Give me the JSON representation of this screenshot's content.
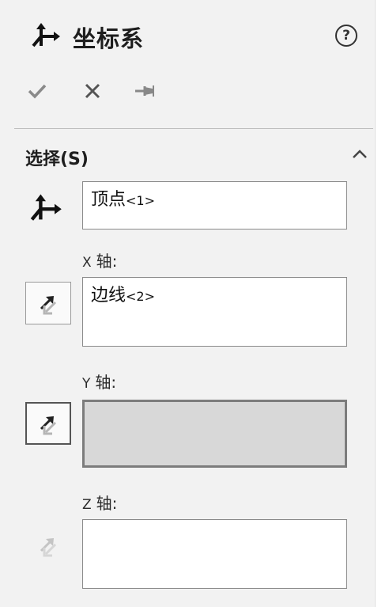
{
  "header": {
    "title": "坐标系",
    "help": "?",
    "icons": [
      "coordinate-system-icon",
      "help-icon",
      "check-icon",
      "close-icon",
      "pin-icon"
    ]
  },
  "selection": {
    "label": "选择(S)",
    "origin": {
      "value": "顶点",
      "count": "<1>",
      "icon": "coordinate-system-icon"
    },
    "axes": [
      {
        "letter": "X",
        "label": "轴:",
        "value": "边线",
        "count": "<2>",
        "icon": "reverse-direction-icon"
      },
      {
        "letter": "Y",
        "label": "轴:",
        "value": "",
        "count": "",
        "icon": "reverse-direction-icon"
      },
      {
        "letter": "Z",
        "label": "轴:",
        "value": "",
        "count": "",
        "icon": "reverse-direction-icon"
      }
    ]
  },
  "colors": {
    "panel": "#f2f2f2",
    "active_field": "#d8d8d8",
    "border": "#8a8a8a"
  }
}
